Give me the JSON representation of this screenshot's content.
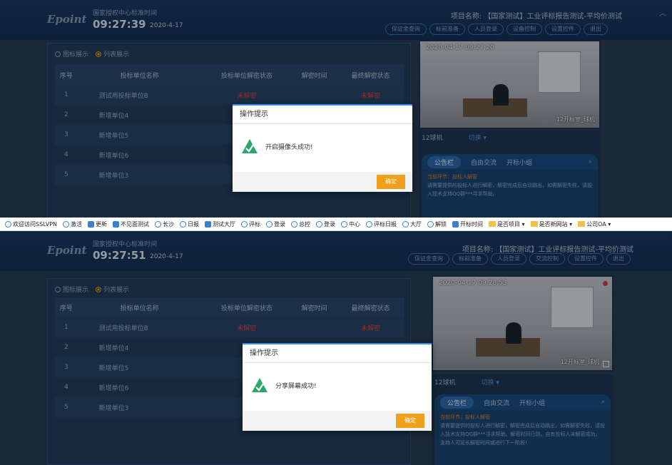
{
  "panel_a": {
    "header": {
      "logo": "Epoint",
      "subtitle": "国家授权中心标准时间",
      "time": "09:27:39",
      "date": "2020-4-17",
      "project": "项目名称: 【国家测试】工业评标报告测试-平均价测试",
      "buttons": [
        "保证金查询",
        "标前准备",
        "人员登录",
        "设备控制",
        "设置控件",
        "退出"
      ]
    },
    "view_toggle": {
      "icon_mode": "图标展示",
      "list_mode": "列表展示"
    },
    "table": {
      "headers": [
        "序号",
        "投标单位名称",
        "投标单位解密状态",
        "解密时间",
        "最终解密状态"
      ],
      "rows": [
        {
          "no": "1",
          "name": "测试用投标单位B",
          "status": "未解密",
          "time": "",
          "final": "未解密"
        },
        {
          "no": "2",
          "name": "新增单位4",
          "status": "",
          "time": "",
          "final": ""
        },
        {
          "no": "3",
          "name": "新增单位5",
          "status": "",
          "time": "",
          "final": ""
        },
        {
          "no": "4",
          "name": "新增单位6",
          "status": "",
          "time": "",
          "final": ""
        },
        {
          "no": "5",
          "name": "新增单位3",
          "status": "",
          "time": "",
          "final": ""
        }
      ]
    },
    "video": {
      "timestamp": "2020-04-17 09:27:20",
      "cam_label": "12开标室_球机"
    },
    "side": {
      "camera": "12球机",
      "switch": "切换 ▾",
      "tabs": [
        "公告栏",
        "自由交流",
        "开标小组"
      ],
      "notice_title": "当前环节：投标人解密",
      "notice_text": "请需要提供的投标人进行解密，解密完成后自动跳出，如需解密失败，请投入技术支持QQ群***寻求帮助。"
    },
    "modal": {
      "title": "操作提示",
      "message": "开启摄像头成功!",
      "ok": "确定"
    }
  },
  "bookmarks": [
    {
      "icon": "ie",
      "label": "欢迎访问SSLVPN"
    },
    {
      "icon": "ie",
      "label": "激活"
    },
    {
      "icon": "blue",
      "label": "更新"
    },
    {
      "icon": "blue",
      "label": "不见面测试"
    },
    {
      "icon": "ie",
      "label": "长沙"
    },
    {
      "icon": "ie",
      "label": "日报"
    },
    {
      "icon": "blue",
      "label": "测试大厅"
    },
    {
      "icon": "ie",
      "label": "评标"
    },
    {
      "icon": "ie",
      "label": "登录"
    },
    {
      "icon": "ie",
      "label": "总控"
    },
    {
      "icon": "ie",
      "label": "登录"
    },
    {
      "icon": "ie",
      "label": "中心"
    },
    {
      "icon": "ie",
      "label": "评标日报"
    },
    {
      "icon": "ie",
      "label": "大厅"
    },
    {
      "icon": "ie",
      "label": "解锁"
    },
    {
      "icon": "blue",
      "label": "开标时间"
    },
    {
      "icon": "folder",
      "label": "是否项目 ▾"
    },
    {
      "icon": "folder",
      "label": "是否新网站 ▾"
    },
    {
      "icon": "folder",
      "label": "公司OA ▾"
    }
  ],
  "panel_b": {
    "header": {
      "logo": "Epoint",
      "subtitle": "国家授权中心标准时间",
      "time": "09:27:51",
      "date": "2020-4-17",
      "project": "项目名称: 【国家测试】工业评标报告测试-平均价测试",
      "buttons": [
        "保证金查询",
        "标前准备",
        "人员登录",
        "交流控制",
        "设置控件",
        "退出"
      ]
    },
    "view_toggle": {
      "icon_mode": "图标展示",
      "list_mode": "列表展示"
    },
    "table": {
      "headers": [
        "序号",
        "投标单位名称",
        "投标单位解密状态",
        "解密时间",
        "最终解密状态"
      ],
      "rows": [
        {
          "no": "1",
          "name": "测试用投标单位B",
          "status": "未解密",
          "time": "",
          "final": "未解密"
        },
        {
          "no": "2",
          "name": "新增单位4",
          "status": "",
          "time": "",
          "final": ""
        },
        {
          "no": "3",
          "name": "新增单位5",
          "status": "",
          "time": "",
          "final": ""
        },
        {
          "no": "4",
          "name": "新增单位6",
          "status": "",
          "time": "",
          "final": ""
        },
        {
          "no": "5",
          "name": "新增单位3",
          "status": "",
          "time": "",
          "final": ""
        }
      ]
    },
    "video": {
      "timestamp": "2020-04-17 09:28:53",
      "cam_label": "12开标室_球机"
    },
    "side": {
      "camera": "12球机",
      "switch": "切换 ▾",
      "tabs": [
        "公告栏",
        "自由交流",
        "开标小组"
      ],
      "notice_title": "当前环节：投标人解密",
      "notice_text": "请需要提供的投标人进行解密，解密完成后自动跳出，如需解密失败，请投入技术支持QQ群***寻求帮助。解密时间已到，自有投标人未解密成功，支持人可延长解密时间或进行下一阶段!"
    },
    "modal": {
      "title": "操作提示",
      "message": "分享屏幕成功!",
      "ok": "确定"
    }
  }
}
